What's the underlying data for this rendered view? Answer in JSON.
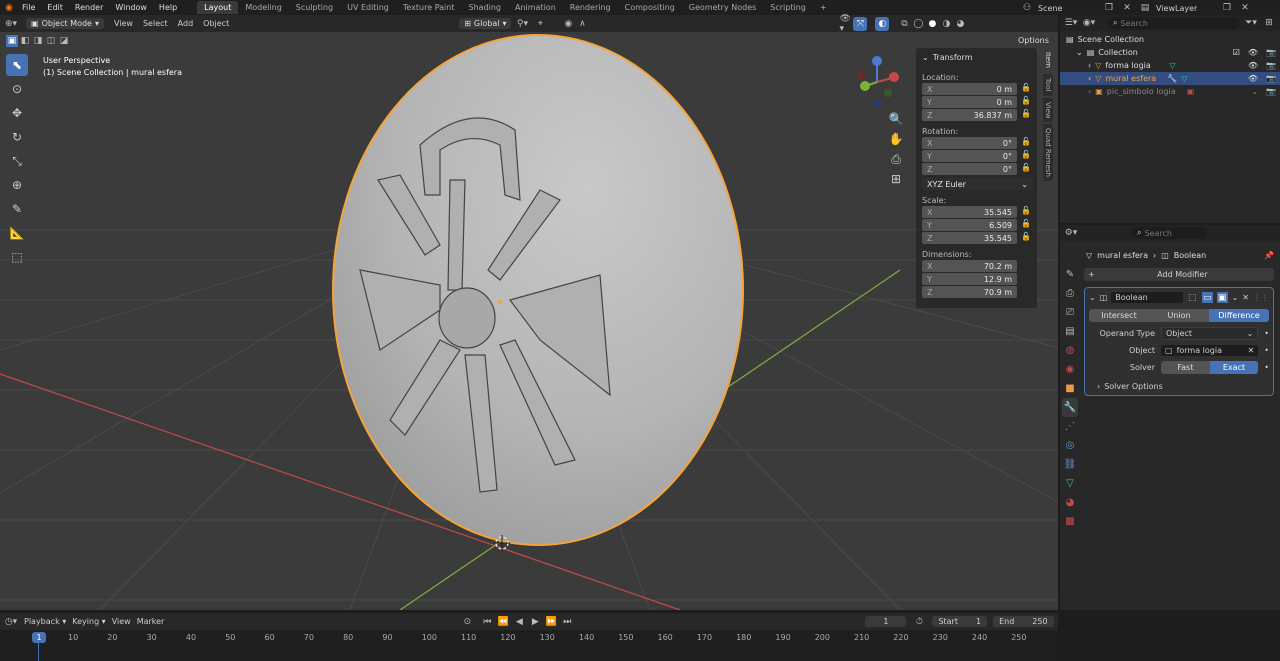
{
  "menu": {
    "items": [
      "File",
      "Edit",
      "Render",
      "Window",
      "Help"
    ],
    "workspaces": [
      "Layout",
      "Modeling",
      "Sculpting",
      "UV Editing",
      "Texture Paint",
      "Shading",
      "Animation",
      "Rendering",
      "Compositing",
      "Geometry Nodes",
      "Scripting"
    ],
    "active_workspace": "Layout",
    "add_tab": "+",
    "scene": "Scene",
    "view_layer": "ViewLayer"
  },
  "viewport_header": {
    "mode": "Object Mode",
    "menus": [
      "View",
      "Select",
      "Add",
      "Object"
    ],
    "orientation": "Global",
    "options": "Options"
  },
  "overlay": {
    "perspective": "User Perspective",
    "collection": "(1) Scene Collection | mural esfera"
  },
  "npanel": {
    "title": "Transform",
    "location_label": "Location:",
    "location": [
      {
        "k": "X",
        "v": "0 m"
      },
      {
        "k": "Y",
        "v": "0 m"
      },
      {
        "k": "Z",
        "v": "36.837 m"
      }
    ],
    "rotation_label": "Rotation:",
    "rotation": [
      {
        "k": "X",
        "v": "0°"
      },
      {
        "k": "Y",
        "v": "0°"
      },
      {
        "k": "Z",
        "v": "0°"
      }
    ],
    "rotation_mode": "XYZ Euler",
    "scale_label": "Scale:",
    "scale": [
      {
        "k": "X",
        "v": "35.545"
      },
      {
        "k": "Y",
        "v": "6.509"
      },
      {
        "k": "Z",
        "v": "35.545"
      }
    ],
    "dimensions_label": "Dimensions:",
    "dimensions": [
      {
        "k": "X",
        "v": "70.2 m"
      },
      {
        "k": "Y",
        "v": "12.9 m"
      },
      {
        "k": "Z",
        "v": "70.9 m"
      }
    ],
    "tabs": [
      "Item",
      "Tool",
      "View",
      "Quad Remesh"
    ]
  },
  "outliner": {
    "search_placeholder": "Search",
    "root": "Scene Collection",
    "collection": "Collection",
    "items": [
      "forma logia",
      "mural esfera",
      "pic_simbolo logia"
    ]
  },
  "properties": {
    "search_placeholder": "Search",
    "object": "mural esfera",
    "modifier": "Boolean",
    "add_modifier": "Add Modifier",
    "modifier_name": "Boolean",
    "operations": [
      "Intersect",
      "Union",
      "Difference"
    ],
    "active_operation": "Difference",
    "operand_type_label": "Operand Type",
    "operand_type": "Object",
    "object_label": "Object",
    "object_value": "forma logia",
    "solver_label": "Solver",
    "solvers": [
      "Fast",
      "Exact"
    ],
    "active_solver": "Exact",
    "solver_options": "Solver Options"
  },
  "timeline": {
    "menus": [
      "Playback",
      "Keying",
      "View",
      "Marker"
    ],
    "current_frame": "1",
    "start_label": "Start",
    "start": "1",
    "end_label": "End",
    "end": "250",
    "ruler": [
      "10",
      "20",
      "30",
      "40",
      "50",
      "60",
      "70",
      "80",
      "90",
      "100",
      "110",
      "120",
      "130",
      "140",
      "150",
      "160",
      "170",
      "180",
      "190",
      "200",
      "210",
      "220",
      "230",
      "240",
      "250"
    ],
    "playhead": "1"
  },
  "colors": {
    "accent": "#4772b3",
    "selection_outline": "#f5a33a",
    "axis_x": "#c44a4a",
    "axis_y": "#7fb03a"
  }
}
